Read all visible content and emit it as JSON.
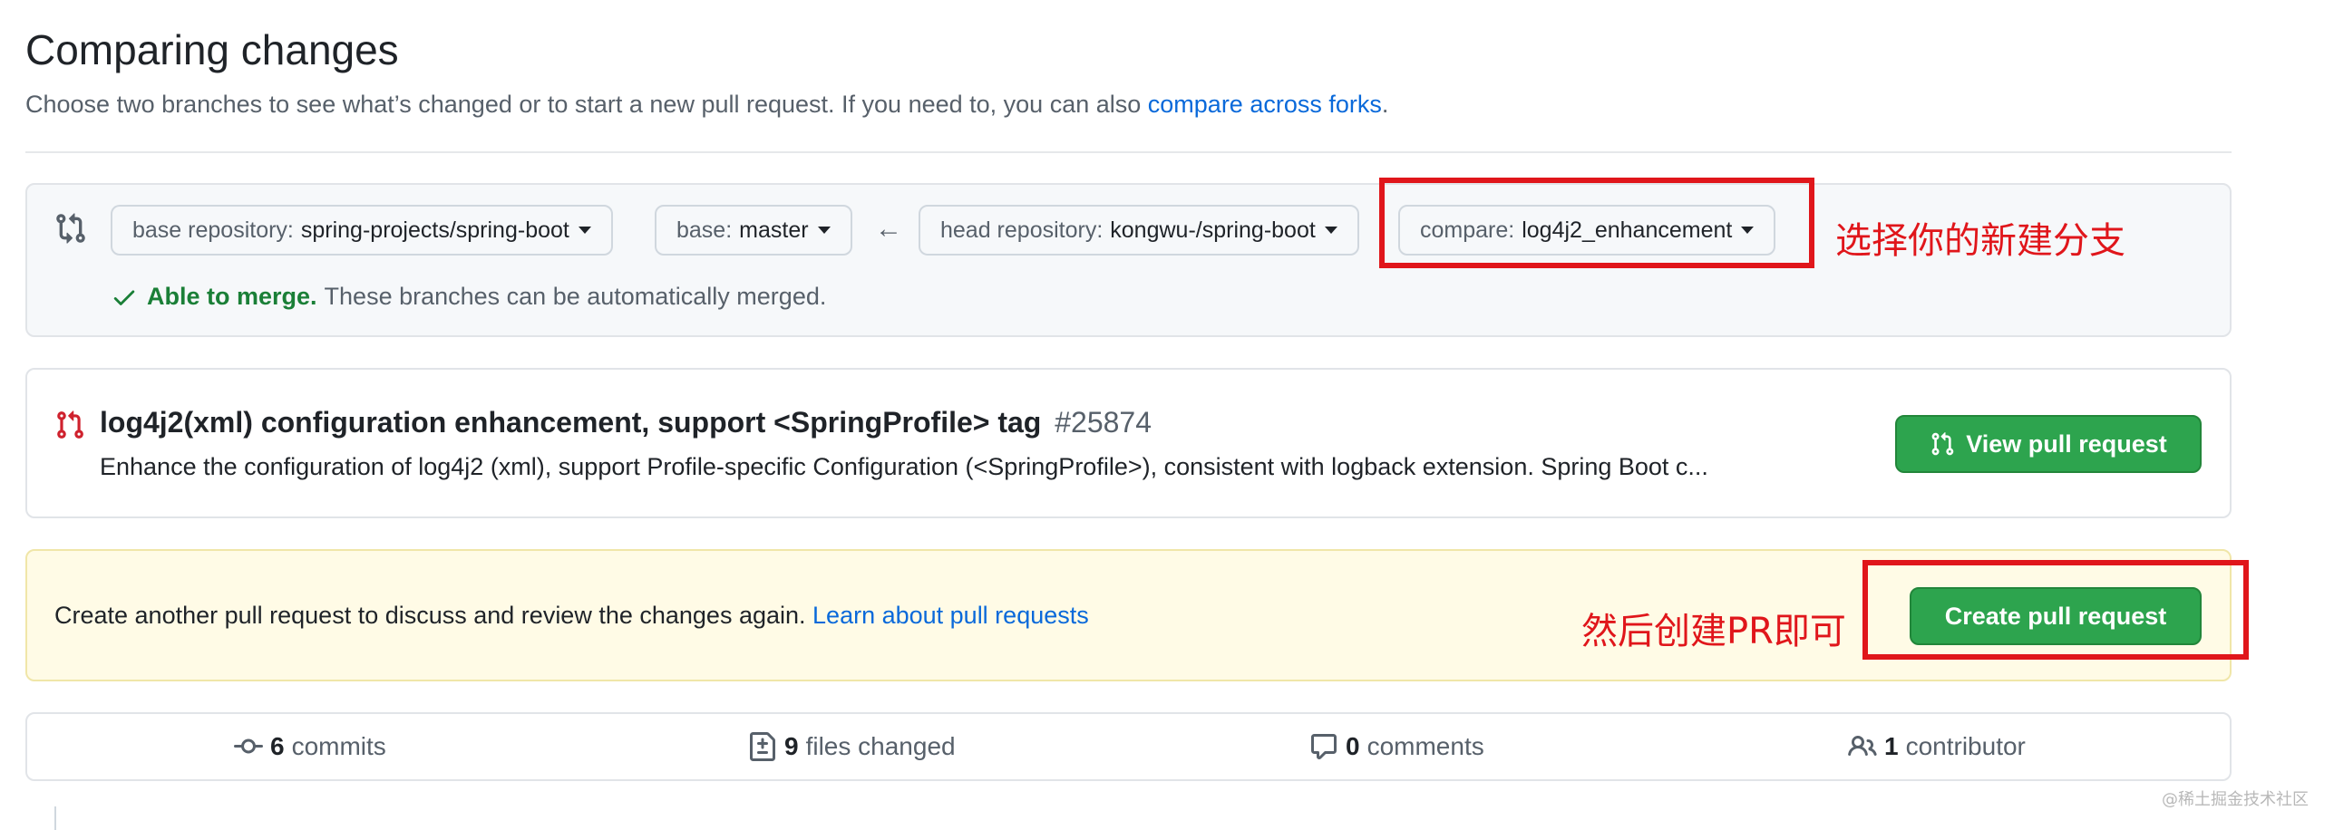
{
  "header": {
    "title": "Comparing changes",
    "subtitle_prefix": "Choose two branches to see what’s changed or to start a new pull request. If you need to, you can also",
    "subtitle_link": "compare across forks",
    "subtitle_suffix": "."
  },
  "range": {
    "base_repo_label": "base repository:",
    "base_repo_value": "spring-projects/spring-boot",
    "base_label": "base:",
    "base_value": "master",
    "arrow": "←",
    "head_repo_label": "head repository:",
    "head_repo_value": "kongwu-/spring-boot",
    "compare_label": "compare:",
    "compare_value": "log4j2_enhancement",
    "merge_ok": "Able to merge.",
    "merge_msg": "These branches can be automatically merged."
  },
  "existing_pr": {
    "title": "log4j2(xml) configuration enhancement, support <SpringProfile> tag",
    "number": "#25874",
    "description": "Enhance the configuration of log4j2 (xml), support Profile-specific Configuration (<SpringProfile>), consistent with logback extension. Spring Boot c...",
    "view_button": "View pull request"
  },
  "info": {
    "text": "Create another pull request to discuss and review the changes again.",
    "link": "Learn about pull requests",
    "create_button": "Create pull request"
  },
  "stats": {
    "commits_count": "6",
    "commits_label": "commits",
    "files_count": "9",
    "files_label": "files changed",
    "comments_count": "0",
    "comments_label": "comments",
    "contributors_count": "1",
    "contributors_label": "contributor"
  },
  "annotations": {
    "select_branch": "选择你的新建分支",
    "create_pr": "然后创建PR即可"
  },
  "watermark": "@稀土掘金技术社区",
  "colors": {
    "accent_green": "#2da44e",
    "link_blue": "#0969da",
    "annotation_red": "#e0161b",
    "info_yellow": "#fffbe6"
  }
}
